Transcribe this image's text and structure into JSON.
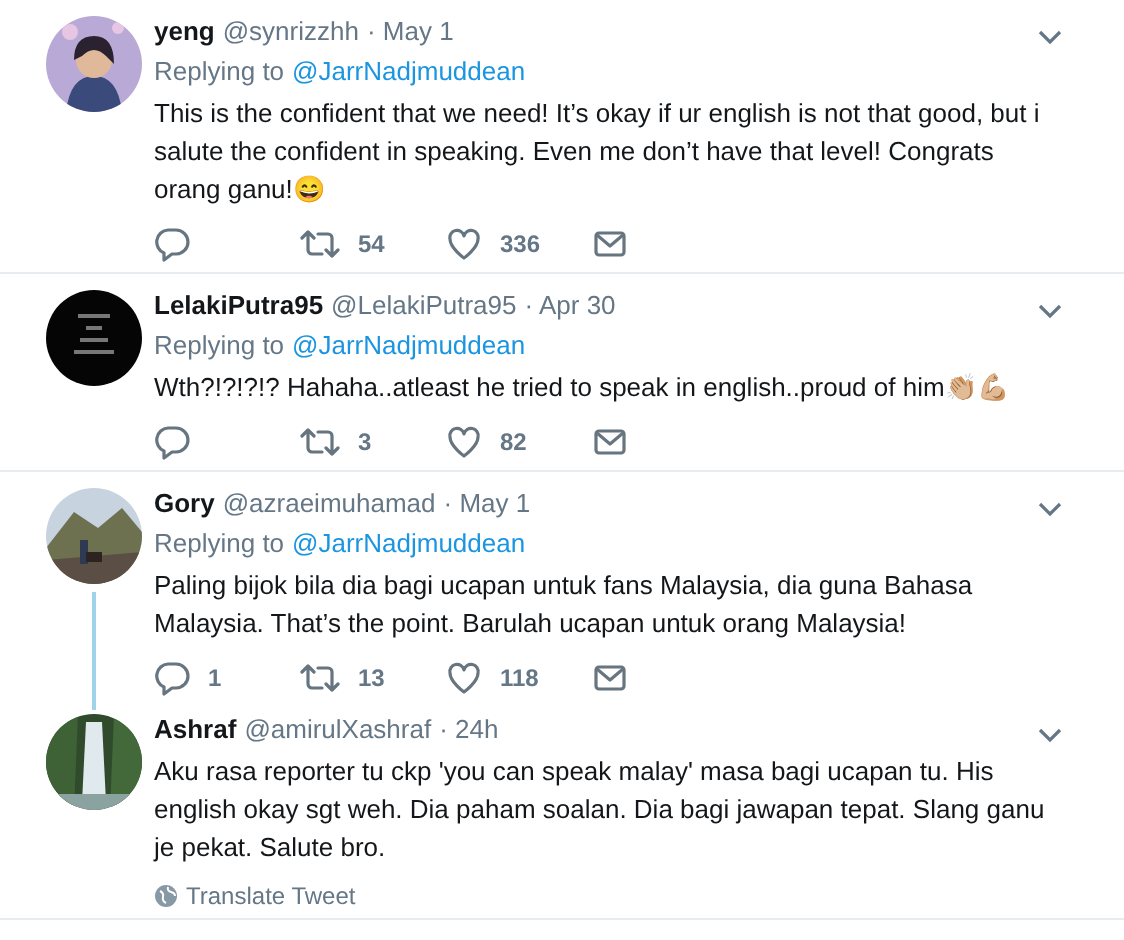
{
  "tweets": [
    {
      "name": "yeng",
      "handle": "@synrizzhh",
      "date": "· May 1",
      "replying_label": "Replying to",
      "replying_handle": "@JarrNadjmuddean",
      "text": "This is the confident that we need! It’s okay if ur english is not that good, but i salute the confident in speaking. Even me don’t have that level! Congrats orang ganu!😄",
      "threaded": false,
      "actions": [
        {
          "kind": "reply"
        },
        {
          "kind": "retweet",
          "count": "54"
        },
        {
          "kind": "like",
          "count": "336"
        },
        {
          "kind": "message"
        }
      ]
    },
    {
      "name": "LelakiPutra95",
      "handle": "@LelakiPutra95",
      "date": "· Apr 30",
      "replying_label": "Replying to",
      "replying_handle": "@JarrNadjmuddean",
      "text": "Wth?!?!?!? Hahaha..atleast he tried to speak in english..proud of him👏🏼💪🏼",
      "threaded": false,
      "actions": [
        {
          "kind": "reply"
        },
        {
          "kind": "retweet",
          "count": "3"
        },
        {
          "kind": "like",
          "count": "82"
        },
        {
          "kind": "message"
        }
      ]
    },
    {
      "name": "Gory",
      "handle": "@azraeimuhamad",
      "date": "· May 1",
      "replying_label": "Replying to",
      "replying_handle": "@JarrNadjmuddean",
      "text": "Paling bijok bila dia bagi ucapan untuk fans Malaysia, dia guna Bahasa Malaysia. That’s the point. Barulah ucapan untuk orang Malaysia!",
      "threaded": true,
      "actions": [
        {
          "kind": "reply",
          "count": "1"
        },
        {
          "kind": "retweet",
          "count": "13"
        },
        {
          "kind": "like",
          "count": "118"
        },
        {
          "kind": "message"
        }
      ]
    },
    {
      "name": "Ashraf",
      "handle": "@amirulXashraf",
      "date": "· 24h",
      "text": "Aku rasa reporter tu ckp 'you can speak malay' masa bagi ucapan tu. His english okay sgt weh. Dia paham soalan. Dia bagi jawapan tepat. Slang ganu je pekat. Salute bro.",
      "threaded": false,
      "translate": "Translate Tweet"
    }
  ]
}
